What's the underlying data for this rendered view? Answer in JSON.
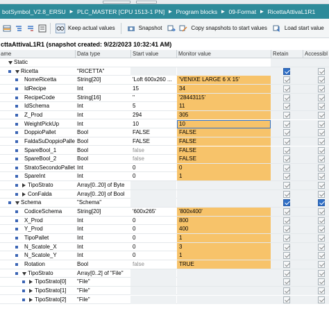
{
  "breadcrumb": [
    "botSymbol_V2.8_ERSU",
    "PLC_MASTER [CPU 1513-1 PN]",
    "Program blocks",
    "09-Format",
    "RicettaAttivaL1R1"
  ],
  "breadcrumb_sep": "▸",
  "toolbar": {
    "keep_actual_values": "Keep actual values",
    "snapshot": "Snapshot",
    "copy_snapshots": "Copy snapshots to start values",
    "load_start_values": "Load start value"
  },
  "title": "cttaAttivaL1R1 (snapshot created: 9/22/2023 10:32:41 AM)",
  "columns": {
    "name": "ame",
    "data_type": "Data type",
    "start_value": "Start value",
    "monitor_value": "Monitor value",
    "retain": "Retain",
    "accessible": "Accessibl"
  },
  "rows": [
    {
      "level": 0,
      "expand": "down",
      "bullet": false,
      "name": "Static",
      "type": "",
      "start": "",
      "monitor": "",
      "mon_style": "none",
      "retain": "none",
      "access": "none"
    },
    {
      "level": 1,
      "expand": "down",
      "bullet": true,
      "name": "Ricetta",
      "type": "\"RICETTA\"",
      "start": "",
      "monitor": "",
      "mon_style": "grey",
      "retain": "blue",
      "access": "on"
    },
    {
      "level": 2,
      "expand": "",
      "bullet": true,
      "name": "NomeRicetta",
      "type": "String[20]",
      "start": "'Loft 600x260 ...",
      "monitor": "'VENIXE LARGE 6 X 15'",
      "mon_style": "orange",
      "retain": "on",
      "access": "on"
    },
    {
      "level": 2,
      "expand": "",
      "bullet": true,
      "name": "IdRecipe",
      "type": "Int",
      "start": "15",
      "monitor": "34",
      "mon_style": "orange",
      "retain": "on",
      "access": "on"
    },
    {
      "level": 2,
      "expand": "",
      "bullet": true,
      "name": "RecipeCode",
      "type": "String[16]",
      "start": "''",
      "monitor": "'28443115'",
      "mon_style": "orange",
      "retain": "on",
      "access": "on"
    },
    {
      "level": 2,
      "expand": "",
      "bullet": true,
      "name": "IdSchema",
      "type": "Int",
      "start": "5",
      "monitor": "11",
      "mon_style": "orange",
      "retain": "on",
      "access": "on"
    },
    {
      "level": 2,
      "expand": "",
      "bullet": true,
      "name": "Z_Prod",
      "type": "Int",
      "start": "294",
      "monitor": "305",
      "mon_style": "orange",
      "retain": "on",
      "access": "on"
    },
    {
      "level": 2,
      "expand": "",
      "bullet": true,
      "name": "WeightPickUp",
      "type": "Int",
      "start": "10",
      "monitor": "10",
      "mon_style": "edit",
      "retain": "on",
      "access": "on"
    },
    {
      "level": 2,
      "expand": "",
      "bullet": true,
      "name": "DoppioPallet",
      "type": "Bool",
      "start": "FALSE",
      "monitor": "FALSE",
      "mon_style": "orange",
      "retain": "on",
      "access": "on"
    },
    {
      "level": 2,
      "expand": "",
      "bullet": true,
      "name": "FaldaSuDoppioPallet",
      "type": "Bool",
      "start": "FALSE",
      "monitor": "FALSE",
      "mon_style": "orange",
      "retain": "on",
      "access": "on"
    },
    {
      "level": 2,
      "expand": "",
      "bullet": true,
      "name": "SpareBool_1",
      "type": "Bool",
      "start": "false",
      "start_dim": true,
      "monitor": "FALSE",
      "mon_style": "orange",
      "retain": "on",
      "access": "on"
    },
    {
      "level": 2,
      "expand": "",
      "bullet": true,
      "name": "SpareBool_2",
      "type": "Bool",
      "start": "false",
      "start_dim": true,
      "monitor": "FALSE",
      "mon_style": "orange",
      "retain": "on",
      "access": "on"
    },
    {
      "level": 2,
      "expand": "",
      "bullet": true,
      "name": "StratoSecondoPallet",
      "type": "Int",
      "start": "0",
      "monitor": "0",
      "mon_style": "orange",
      "retain": "on",
      "access": "on"
    },
    {
      "level": 2,
      "expand": "",
      "bullet": true,
      "name": "SpareInt",
      "type": "Int",
      "start": "0",
      "monitor": "1",
      "mon_style": "orange",
      "retain": "on",
      "access": "on"
    },
    {
      "level": 2,
      "expand": "right",
      "bullet": true,
      "name": "TipoStrato",
      "type": "Array[0..20] of Byte",
      "start": "",
      "monitor": "",
      "mon_style": "grey",
      "retain": "on",
      "access": "on"
    },
    {
      "level": 2,
      "expand": "right",
      "bullet": true,
      "name": "ConFalda",
      "type": "Array[0..20] of Bool",
      "start": "",
      "monitor": "",
      "mon_style": "grey",
      "retain": "on",
      "access": "on"
    },
    {
      "level": 1,
      "expand": "down",
      "bullet": true,
      "name": "Schema",
      "type": "\"Schema\"",
      "start": "",
      "monitor": "",
      "mon_style": "grey",
      "retain": "blue",
      "access": "blue"
    },
    {
      "level": 2,
      "expand": "",
      "bullet": true,
      "name": "CodiceSchema",
      "type": "String[20]",
      "start": "'600x265'",
      "monitor": "'800x400'",
      "mon_style": "orange",
      "retain": "on",
      "access": "on"
    },
    {
      "level": 2,
      "expand": "",
      "bullet": true,
      "name": "X_Prod",
      "type": "Int",
      "start": "0",
      "monitor": "800",
      "mon_style": "orange",
      "retain": "on",
      "access": "on"
    },
    {
      "level": 2,
      "expand": "",
      "bullet": true,
      "name": "Y_Prod",
      "type": "Int",
      "start": "0",
      "monitor": "400",
      "mon_style": "orange",
      "retain": "on",
      "access": "on"
    },
    {
      "level": 2,
      "expand": "",
      "bullet": true,
      "name": "TipoPallet",
      "type": "Int",
      "start": "0",
      "monitor": "1",
      "mon_style": "orange",
      "retain": "on",
      "access": "on"
    },
    {
      "level": 2,
      "expand": "",
      "bullet": true,
      "name": "N_Scatole_X",
      "type": "Int",
      "start": "0",
      "monitor": "3",
      "mon_style": "orange",
      "retain": "on",
      "access": "on"
    },
    {
      "level": 2,
      "expand": "",
      "bullet": true,
      "name": "N_Scatole_Y",
      "type": "Int",
      "start": "0",
      "monitor": "1",
      "mon_style": "orange",
      "retain": "on",
      "access": "on"
    },
    {
      "level": 2,
      "expand": "",
      "bullet": true,
      "name": "Rotation",
      "type": "Bool",
      "start": "false",
      "start_dim": true,
      "monitor": "TRUE",
      "mon_style": "orange",
      "retain": "on",
      "access": "on"
    },
    {
      "level": 2,
      "expand": "down",
      "bullet": true,
      "name": "TipoStrato",
      "type": "Array[0..2] of \"File\"",
      "start": "",
      "monitor": "",
      "mon_style": "grey",
      "retain": "on",
      "access": "on"
    },
    {
      "level": 3,
      "expand": "right",
      "bullet": true,
      "name": "TipoStrato[0]",
      "type": "\"File\"",
      "start": "",
      "monitor": "",
      "mon_style": "grey",
      "retain": "on",
      "access": "on"
    },
    {
      "level": 3,
      "expand": "right",
      "bullet": true,
      "name": "TipoStrato[1]",
      "type": "\"File\"",
      "start": "",
      "monitor": "",
      "mon_style": "grey",
      "retain": "on",
      "access": "on"
    },
    {
      "level": 3,
      "expand": "right",
      "bullet": true,
      "name": "TipoStrato[2]",
      "type": "\"File\"",
      "start": "",
      "monitor": "",
      "mon_style": "grey",
      "retain": "on",
      "access": "on"
    }
  ],
  "colors": {
    "breadcrumb_bg": "#2e8b9a",
    "monitor_orange": "#f7c36a",
    "checkbox_blue": "#2f6fc6"
  }
}
